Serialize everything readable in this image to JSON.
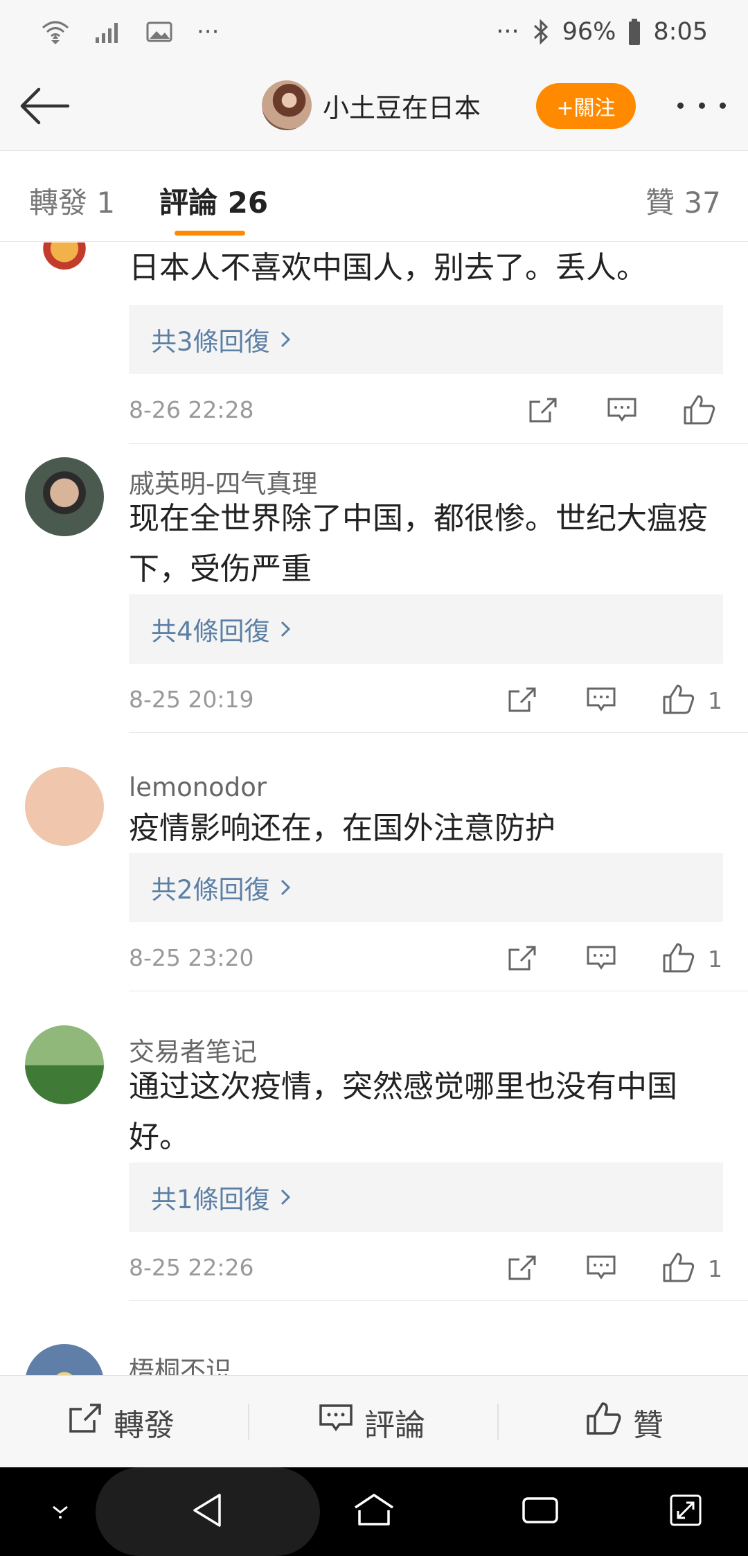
{
  "status_bar": {
    "battery": "96%",
    "time": "8:05",
    "more_left": "···",
    "more_right": "···"
  },
  "header": {
    "user_name": "小土豆在日本",
    "follow_label": "+關注"
  },
  "tabs": {
    "repost": {
      "label": "轉發",
      "count": "1"
    },
    "comment": {
      "label": "評論",
      "count": "26"
    },
    "like": {
      "label": "贊",
      "count": "37"
    }
  },
  "comments": [
    {
      "text": "日本人不喜欢中国人，别去了。丢人。",
      "replies": "共3條回復",
      "time": "8-26 22:28",
      "likes": ""
    },
    {
      "user": "戚英明-四气真理",
      "text": "现在全世界除了中国，都很惨。世纪大瘟疫下，受伤严重",
      "replies": "共4條回復",
      "time": "8-25 20:19",
      "likes": "1"
    },
    {
      "user": "lemonodor",
      "text": "疫情影响还在，在国外注意防护",
      "replies": "共2條回復",
      "time": "8-25 23:20",
      "likes": "1"
    },
    {
      "user": "交易者笔记",
      "text": "通过这次疫情，突然感觉哪里也没有中国好。",
      "replies": "共1條回復",
      "time": "8-25 22:26",
      "likes": "1"
    },
    {
      "user": "梧桐不识"
    }
  ],
  "bottom_bar": {
    "repost": "轉發",
    "comment": "評論",
    "like": "贊"
  },
  "colors": {
    "accent": "#ff8a00",
    "link": "#5b7fa5"
  },
  "icons": [
    "back-arrow-icon",
    "share-icon",
    "comment-icon",
    "thumbs-up-icon"
  ]
}
